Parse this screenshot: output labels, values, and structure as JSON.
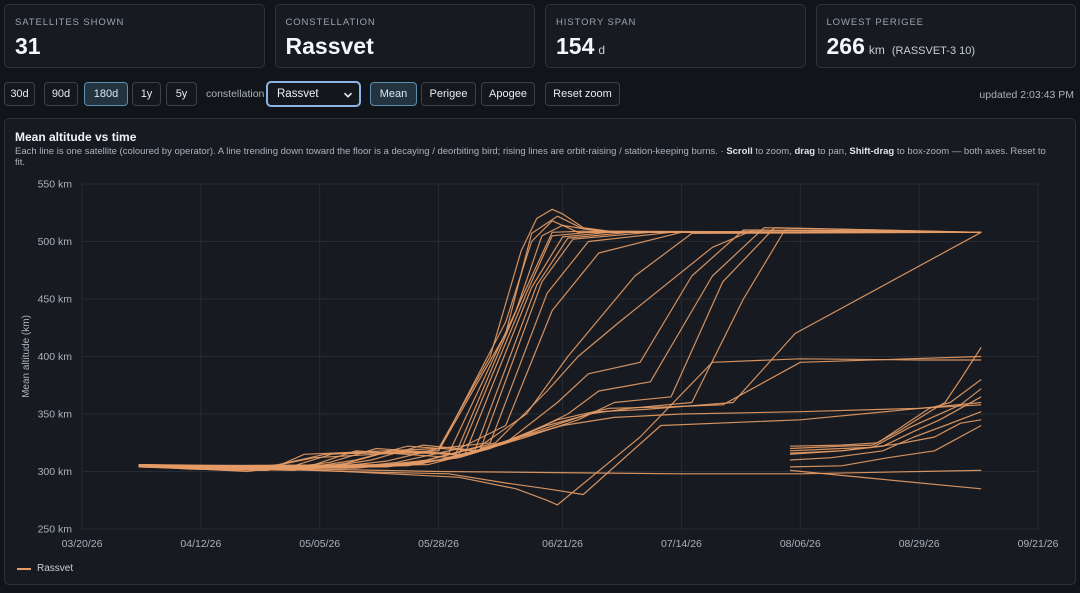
{
  "stats": [
    {
      "label": "Satellites shown",
      "value": "31",
      "unit": "",
      "sub": ""
    },
    {
      "label": "Constellation",
      "value": "Rassvet",
      "unit": "",
      "sub": ""
    },
    {
      "label": "History span",
      "value": "154",
      "unit": "d",
      "sub": ""
    },
    {
      "label": "Lowest perigee",
      "value": "266",
      "unit": "km",
      "sub": "(RASSVET-3 10)"
    }
  ],
  "toolbar": {
    "ranges": [
      "30d",
      "90d",
      "180d",
      "1y",
      "5y"
    ],
    "active_range": "180d",
    "constellation_label": "constellation",
    "constellation_value": "Rassvet",
    "metrics": [
      "Mean",
      "Perigee",
      "Apogee"
    ],
    "active_metric": "Mean",
    "reset_label": "Reset zoom",
    "updated": "updated 2:03:43 PM"
  },
  "panel": {
    "title": "Mean altitude vs time",
    "desc_1": "Each line is one satellite (coloured by operator). A line trending down toward the floor is a decaying / deorbiting bird; rising lines are orbit-raising / station-keeping burns. · ",
    "desc_scroll": "Scroll",
    "desc_2": " to zoom, ",
    "desc_drag": "drag",
    "desc_3": " to pan, ",
    "desc_shift": "Shift-drag",
    "desc_4": " to box-zoom — both axes. Reset to fit."
  },
  "colors": {
    "series": "#e59b66",
    "grid": "#262b33",
    "accent": "#8cb4ea"
  },
  "chart_data": {
    "type": "line",
    "ylabel": "Mean altitude (km)",
    "ylim": [
      250,
      550
    ],
    "yticks": [
      550,
      500,
      450,
      400,
      350,
      300,
      250
    ],
    "ytick_labels": [
      "550 km",
      "500 km",
      "450 km",
      "400 km",
      "350 km",
      "300 km",
      "250 km"
    ],
    "xlim": [
      "2026-03-20",
      "2026-09-21"
    ],
    "xticks": [
      "2026-03-20",
      "2026-04-12",
      "2026-05-05",
      "2026-05-28",
      "2026-06-21",
      "2026-07-14",
      "2026-08-06",
      "2026-08-29",
      "2026-09-21"
    ],
    "xtick_labels": [
      "03/20/26",
      "04/12/26",
      "05/05/26",
      "05/28/26",
      "06/21/26",
      "07/14/26",
      "08/06/26",
      "08/29/26",
      "09/21/26"
    ],
    "grid": true,
    "legend": "bottom-left",
    "series_name": "Rassvet",
    "series_color": "#e59b66",
    "series": [
      {
        "x": [
          "2026-03-31",
          "2026-04-10",
          "2026-04-25",
          "2026-05-02",
          "2026-05-28",
          "2026-06-07",
          "2026-06-13",
          "2026-06-16",
          "2026-06-19",
          "2026-06-21",
          "2026-06-25",
          "2026-06-30",
          "2026-07-21",
          "2026-09-10"
        ],
        "y": [
          305,
          302,
          301,
          315,
          320,
          400,
          492,
          520,
          528,
          524,
          512,
          509,
          508,
          508
        ]
      },
      {
        "x": [
          "2026-03-31",
          "2026-04-15",
          "2026-04-24",
          "2026-05-04",
          "2026-05-28",
          "2026-06-10",
          "2026-06-15",
          "2026-06-20",
          "2026-06-25",
          "2026-07-02",
          "2026-09-10"
        ],
        "y": [
          306,
          302,
          303,
          312,
          318,
          420,
          507,
          522,
          511,
          508,
          508
        ]
      },
      {
        "x": [
          "2026-03-31",
          "2026-04-18",
          "2026-04-27",
          "2026-05-06",
          "2026-05-28",
          "2026-06-10",
          "2026-06-15",
          "2026-06-19",
          "2026-06-24",
          "2026-09-10"
        ],
        "y": [
          304,
          301,
          306,
          315,
          318,
          430,
          500,
          518,
          508,
          508
        ]
      },
      {
        "x": [
          "2026-03-31",
          "2026-04-21",
          "2026-04-30",
          "2026-05-08",
          "2026-05-30",
          "2026-06-12",
          "2026-06-17",
          "2026-06-21",
          "2026-06-28",
          "2026-09-10"
        ],
        "y": [
          305,
          300,
          305,
          316,
          316,
          440,
          505,
          514,
          509,
          508
        ]
      },
      {
        "x": [
          "2026-03-31",
          "2026-04-24",
          "2026-05-04",
          "2026-05-12",
          "2026-05-31",
          "2026-06-13",
          "2026-06-19",
          "2026-06-25",
          "2026-07-04",
          "2026-09-10"
        ],
        "y": [
          306,
          301,
          306,
          318,
          312,
          450,
          508,
          509,
          508,
          508
        ]
      },
      {
        "x": [
          "2026-03-31",
          "2026-04-27",
          "2026-05-07",
          "2026-05-16",
          "2026-06-01",
          "2026-06-14",
          "2026-06-19",
          "2026-06-26",
          "2026-09-10"
        ],
        "y": [
          305,
          302,
          308,
          320,
          315,
          455,
          505,
          508,
          508
        ]
      },
      {
        "x": [
          "2026-03-31",
          "2026-04-30",
          "2026-05-10",
          "2026-05-19",
          "2026-06-02",
          "2026-06-15",
          "2026-06-21",
          "2026-06-30",
          "2026-09-10"
        ],
        "y": [
          304,
          301,
          307,
          318,
          314,
          460,
          504,
          508,
          508
        ]
      },
      {
        "x": [
          "2026-03-31",
          "2026-05-02",
          "2026-05-12",
          "2026-05-22",
          "2026-06-04",
          "2026-06-16",
          "2026-06-22",
          "2026-07-04",
          "2026-09-10"
        ],
        "y": [
          305,
          303,
          310,
          322,
          318,
          462,
          503,
          508,
          508
        ]
      },
      {
        "x": [
          "2026-03-31",
          "2026-05-05",
          "2026-05-15",
          "2026-05-25",
          "2026-06-05",
          "2026-06-17",
          "2026-06-23",
          "2026-07-08",
          "2026-09-10"
        ],
        "y": [
          306,
          303,
          310,
          323,
          318,
          465,
          502,
          508,
          508
        ]
      },
      {
        "x": [
          "2026-03-31",
          "2026-05-08",
          "2026-05-18",
          "2026-05-28",
          "2026-06-07",
          "2026-06-18",
          "2026-06-26",
          "2026-07-12",
          "2026-09-10"
        ],
        "y": [
          305,
          304,
          309,
          320,
          325,
          455,
          500,
          508,
          508
        ]
      },
      {
        "x": [
          "2026-03-31",
          "2026-05-10",
          "2026-05-20",
          "2026-06-01",
          "2026-06-10",
          "2026-06-19",
          "2026-06-28",
          "2026-07-14",
          "2026-09-10"
        ],
        "y": [
          304,
          303,
          308,
          320,
          340,
          440,
          490,
          508,
          508
        ]
      },
      {
        "x": [
          "2026-03-31",
          "2026-05-12",
          "2026-05-24",
          "2026-06-05",
          "2026-06-14",
          "2026-06-22",
          "2026-07-05",
          "2026-07-16",
          "2026-09-10"
        ],
        "y": [
          305,
          303,
          308,
          322,
          350,
          400,
          470,
          507,
          508
        ]
      },
      {
        "x": [
          "2026-03-31",
          "2026-05-14",
          "2026-05-26",
          "2026-06-08",
          "2026-06-18",
          "2026-06-24",
          "2026-07-02",
          "2026-07-20",
          "2026-07-28",
          "2026-09-10"
        ],
        "y": [
          306,
          304,
          310,
          325,
          370,
          400,
          430,
          495,
          510,
          508
        ]
      },
      {
        "x": [
          "2026-03-31",
          "2026-05-16",
          "2026-05-28",
          "2026-06-10",
          "2026-06-20",
          "2026-06-26",
          "2026-07-06",
          "2026-07-16",
          "2026-07-26",
          "2026-09-10"
        ],
        "y": [
          305,
          304,
          310,
          325,
          360,
          385,
          395,
          470,
          510,
          508
        ]
      },
      {
        "x": [
          "2026-03-31",
          "2026-05-18",
          "2026-05-30",
          "2026-06-12",
          "2026-06-22",
          "2026-06-28",
          "2026-07-08",
          "2026-07-20",
          "2026-07-30",
          "2026-09-10"
        ],
        "y": [
          304,
          304,
          311,
          328,
          350,
          370,
          378,
          470,
          512,
          508
        ]
      },
      {
        "x": [
          "2026-03-31",
          "2026-05-20",
          "2026-06-01",
          "2026-06-14",
          "2026-06-24",
          "2026-07-01",
          "2026-07-12",
          "2026-07-22",
          "2026-08-01",
          "2026-09-10"
        ],
        "y": [
          305,
          305,
          312,
          330,
          345,
          360,
          365,
          465,
          512,
          508
        ]
      },
      {
        "x": [
          "2026-03-31",
          "2026-05-22",
          "2026-06-03",
          "2026-06-16",
          "2026-06-26",
          "2026-07-04",
          "2026-07-16",
          "2026-07-26",
          "2026-08-03",
          "2026-09-10"
        ],
        "y": [
          304,
          305,
          315,
          335,
          350,
          355,
          360,
          450,
          510,
          508
        ]
      },
      {
        "x": [
          "2026-03-31",
          "2026-05-24",
          "2026-06-05",
          "2026-06-18",
          "2026-06-28",
          "2026-07-07",
          "2026-07-24",
          "2026-08-05",
          "2026-09-10"
        ],
        "y": [
          305,
          306,
          318,
          340,
          352,
          354,
          360,
          420,
          508
        ]
      },
      {
        "x": [
          "2026-03-31",
          "2026-05-26",
          "2026-06-07",
          "2026-06-20",
          "2026-06-30",
          "2026-07-10",
          "2026-07-22",
          "2026-08-06",
          "2026-09-10"
        ],
        "y": [
          304,
          306,
          320,
          345,
          355,
          356,
          358,
          395,
          400
        ]
      },
      {
        "x": [
          "2026-03-31",
          "2026-04-20",
          "2026-05-10",
          "2026-06-01",
          "2026-06-12",
          "2026-06-18",
          "2026-06-20",
          "2026-07-06",
          "2026-07-20",
          "2026-08-06",
          "2026-08-29",
          "2026-09-10"
        ],
        "y": [
          306,
          304,
          300,
          295,
          285,
          275,
          271,
          330,
          395,
          398,
          397,
          397
        ]
      },
      {
        "x": [
          "2026-03-31",
          "2026-04-20",
          "2026-05-10",
          "2026-05-30",
          "2026-06-10",
          "2026-06-18",
          "2026-06-25",
          "2026-07-10",
          "2026-08-06",
          "2026-09-10"
        ],
        "y": [
          305,
          303,
          300,
          298,
          290,
          285,
          280,
          340,
          345,
          360
        ]
      },
      {
        "x": [
          "2026-03-31",
          "2026-04-12",
          "2026-05-05",
          "2026-05-28",
          "2026-06-20",
          "2026-07-14",
          "2026-08-06",
          "2026-08-29",
          "2026-09-10"
        ],
        "y": [
          306,
          304,
          302,
          300,
          299,
          298,
          298,
          300,
          301
        ]
      },
      {
        "x": [
          "2026-06-05",
          "2026-06-21",
          "2026-07-01",
          "2026-07-14",
          "2026-08-06",
          "2026-08-29",
          "2026-09-10"
        ],
        "y": [
          320,
          340,
          347,
          350,
          352,
          355,
          358
        ]
      },
      {
        "x": [
          "2026-08-04",
          "2026-08-14",
          "2026-08-20",
          "2026-08-25",
          "2026-08-31",
          "2026-09-03",
          "2026-09-06",
          "2026-09-10"
        ],
        "y": [
          320,
          322,
          323,
          335,
          352,
          360,
          380,
          408
        ]
      },
      {
        "x": [
          "2026-08-04",
          "2026-08-14",
          "2026-08-21",
          "2026-08-26",
          "2026-08-31",
          "2026-09-04",
          "2026-09-10"
        ],
        "y": [
          322,
          323,
          325,
          340,
          355,
          360,
          380
        ]
      },
      {
        "x": [
          "2026-08-04",
          "2026-08-14",
          "2026-08-20",
          "2026-08-27",
          "2026-09-01",
          "2026-09-06",
          "2026-09-10"
        ],
        "y": [
          318,
          320,
          321,
          338,
          348,
          358,
          372
        ]
      },
      {
        "x": [
          "2026-08-04",
          "2026-08-14",
          "2026-08-22",
          "2026-08-28",
          "2026-09-02",
          "2026-09-10"
        ],
        "y": [
          316,
          318,
          322,
          335,
          345,
          365
        ]
      },
      {
        "x": [
          "2026-08-04",
          "2026-08-12",
          "2026-08-22",
          "2026-08-28",
          "2026-09-03",
          "2026-09-10"
        ],
        "y": [
          310,
          312,
          318,
          330,
          340,
          352
        ]
      },
      {
        "x": [
          "2026-08-04",
          "2026-08-14",
          "2026-08-25",
          "2026-09-01",
          "2026-09-06",
          "2026-09-10"
        ],
        "y": [
          315,
          318,
          324,
          330,
          342,
          345
        ]
      },
      {
        "x": [
          "2026-08-04",
          "2026-08-14",
          "2026-08-23",
          "2026-09-01",
          "2026-09-10"
        ],
        "y": [
          304,
          305,
          312,
          318,
          340
        ]
      },
      {
        "x": [
          "2026-08-04",
          "2026-08-20",
          "2026-09-10"
        ],
        "y": [
          301,
          294,
          285
        ]
      }
    ]
  }
}
